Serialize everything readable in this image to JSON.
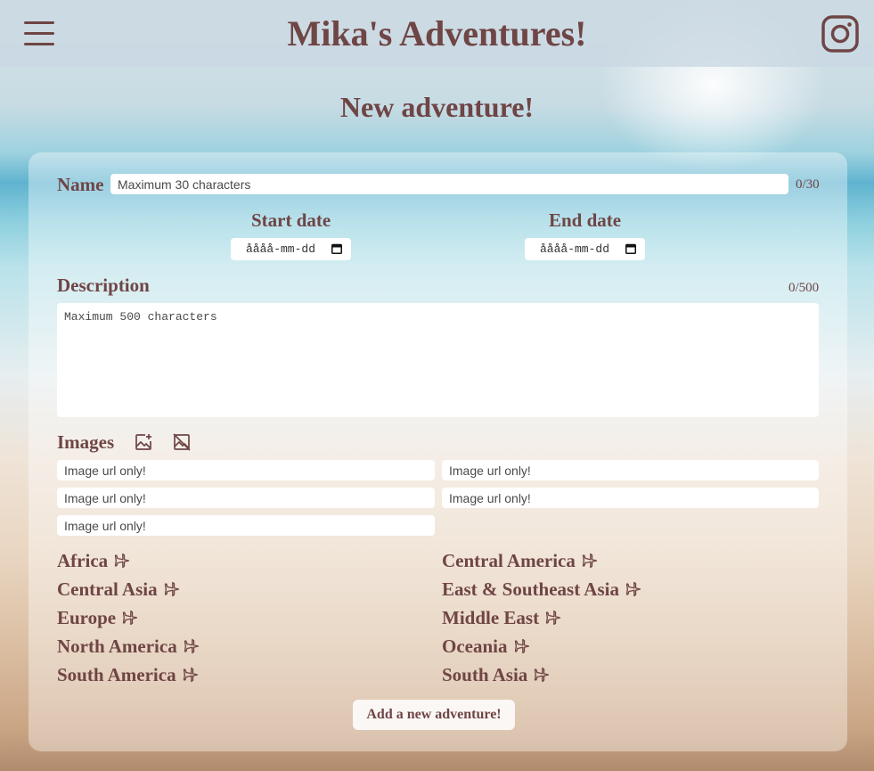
{
  "header": {
    "title": "Mika's Adventures!"
  },
  "page_heading": "New adventure!",
  "form": {
    "name": {
      "label": "Name",
      "placeholder": "Maximum 30 characters",
      "counter": "0/30"
    },
    "start_date": {
      "label": "Start date",
      "value": "åååå-mm-dd"
    },
    "end_date": {
      "label": "End date",
      "value": "åååå-mm-dd"
    },
    "description": {
      "label": "Description",
      "placeholder": "Maximum 500 characters",
      "counter": "0/500"
    },
    "images": {
      "label": "Images",
      "fields": [
        {
          "placeholder": "Image url only!"
        },
        {
          "placeholder": "Image url only!"
        },
        {
          "placeholder": "Image url only!"
        },
        {
          "placeholder": "Image url only!"
        },
        {
          "placeholder": "Image url only!"
        }
      ]
    },
    "regions": [
      {
        "label": "Africa"
      },
      {
        "label": "Central America"
      },
      {
        "label": "Central Asia"
      },
      {
        "label": "East & Southeast Asia"
      },
      {
        "label": "Europe"
      },
      {
        "label": "Middle East"
      },
      {
        "label": "North America"
      },
      {
        "label": "Oceania"
      },
      {
        "label": "South America"
      },
      {
        "label": "South Asia"
      }
    ],
    "submit_label": "Add a new adventure!"
  },
  "colors": {
    "text": "#6f4545",
    "card_background": "rgba(255,255,255,0.38)"
  },
  "icons": [
    "hamburger-menu-icon",
    "instagram-icon",
    "calendar-icon",
    "add-image-icon",
    "remove-image-icon",
    "airplane-icon"
  ]
}
